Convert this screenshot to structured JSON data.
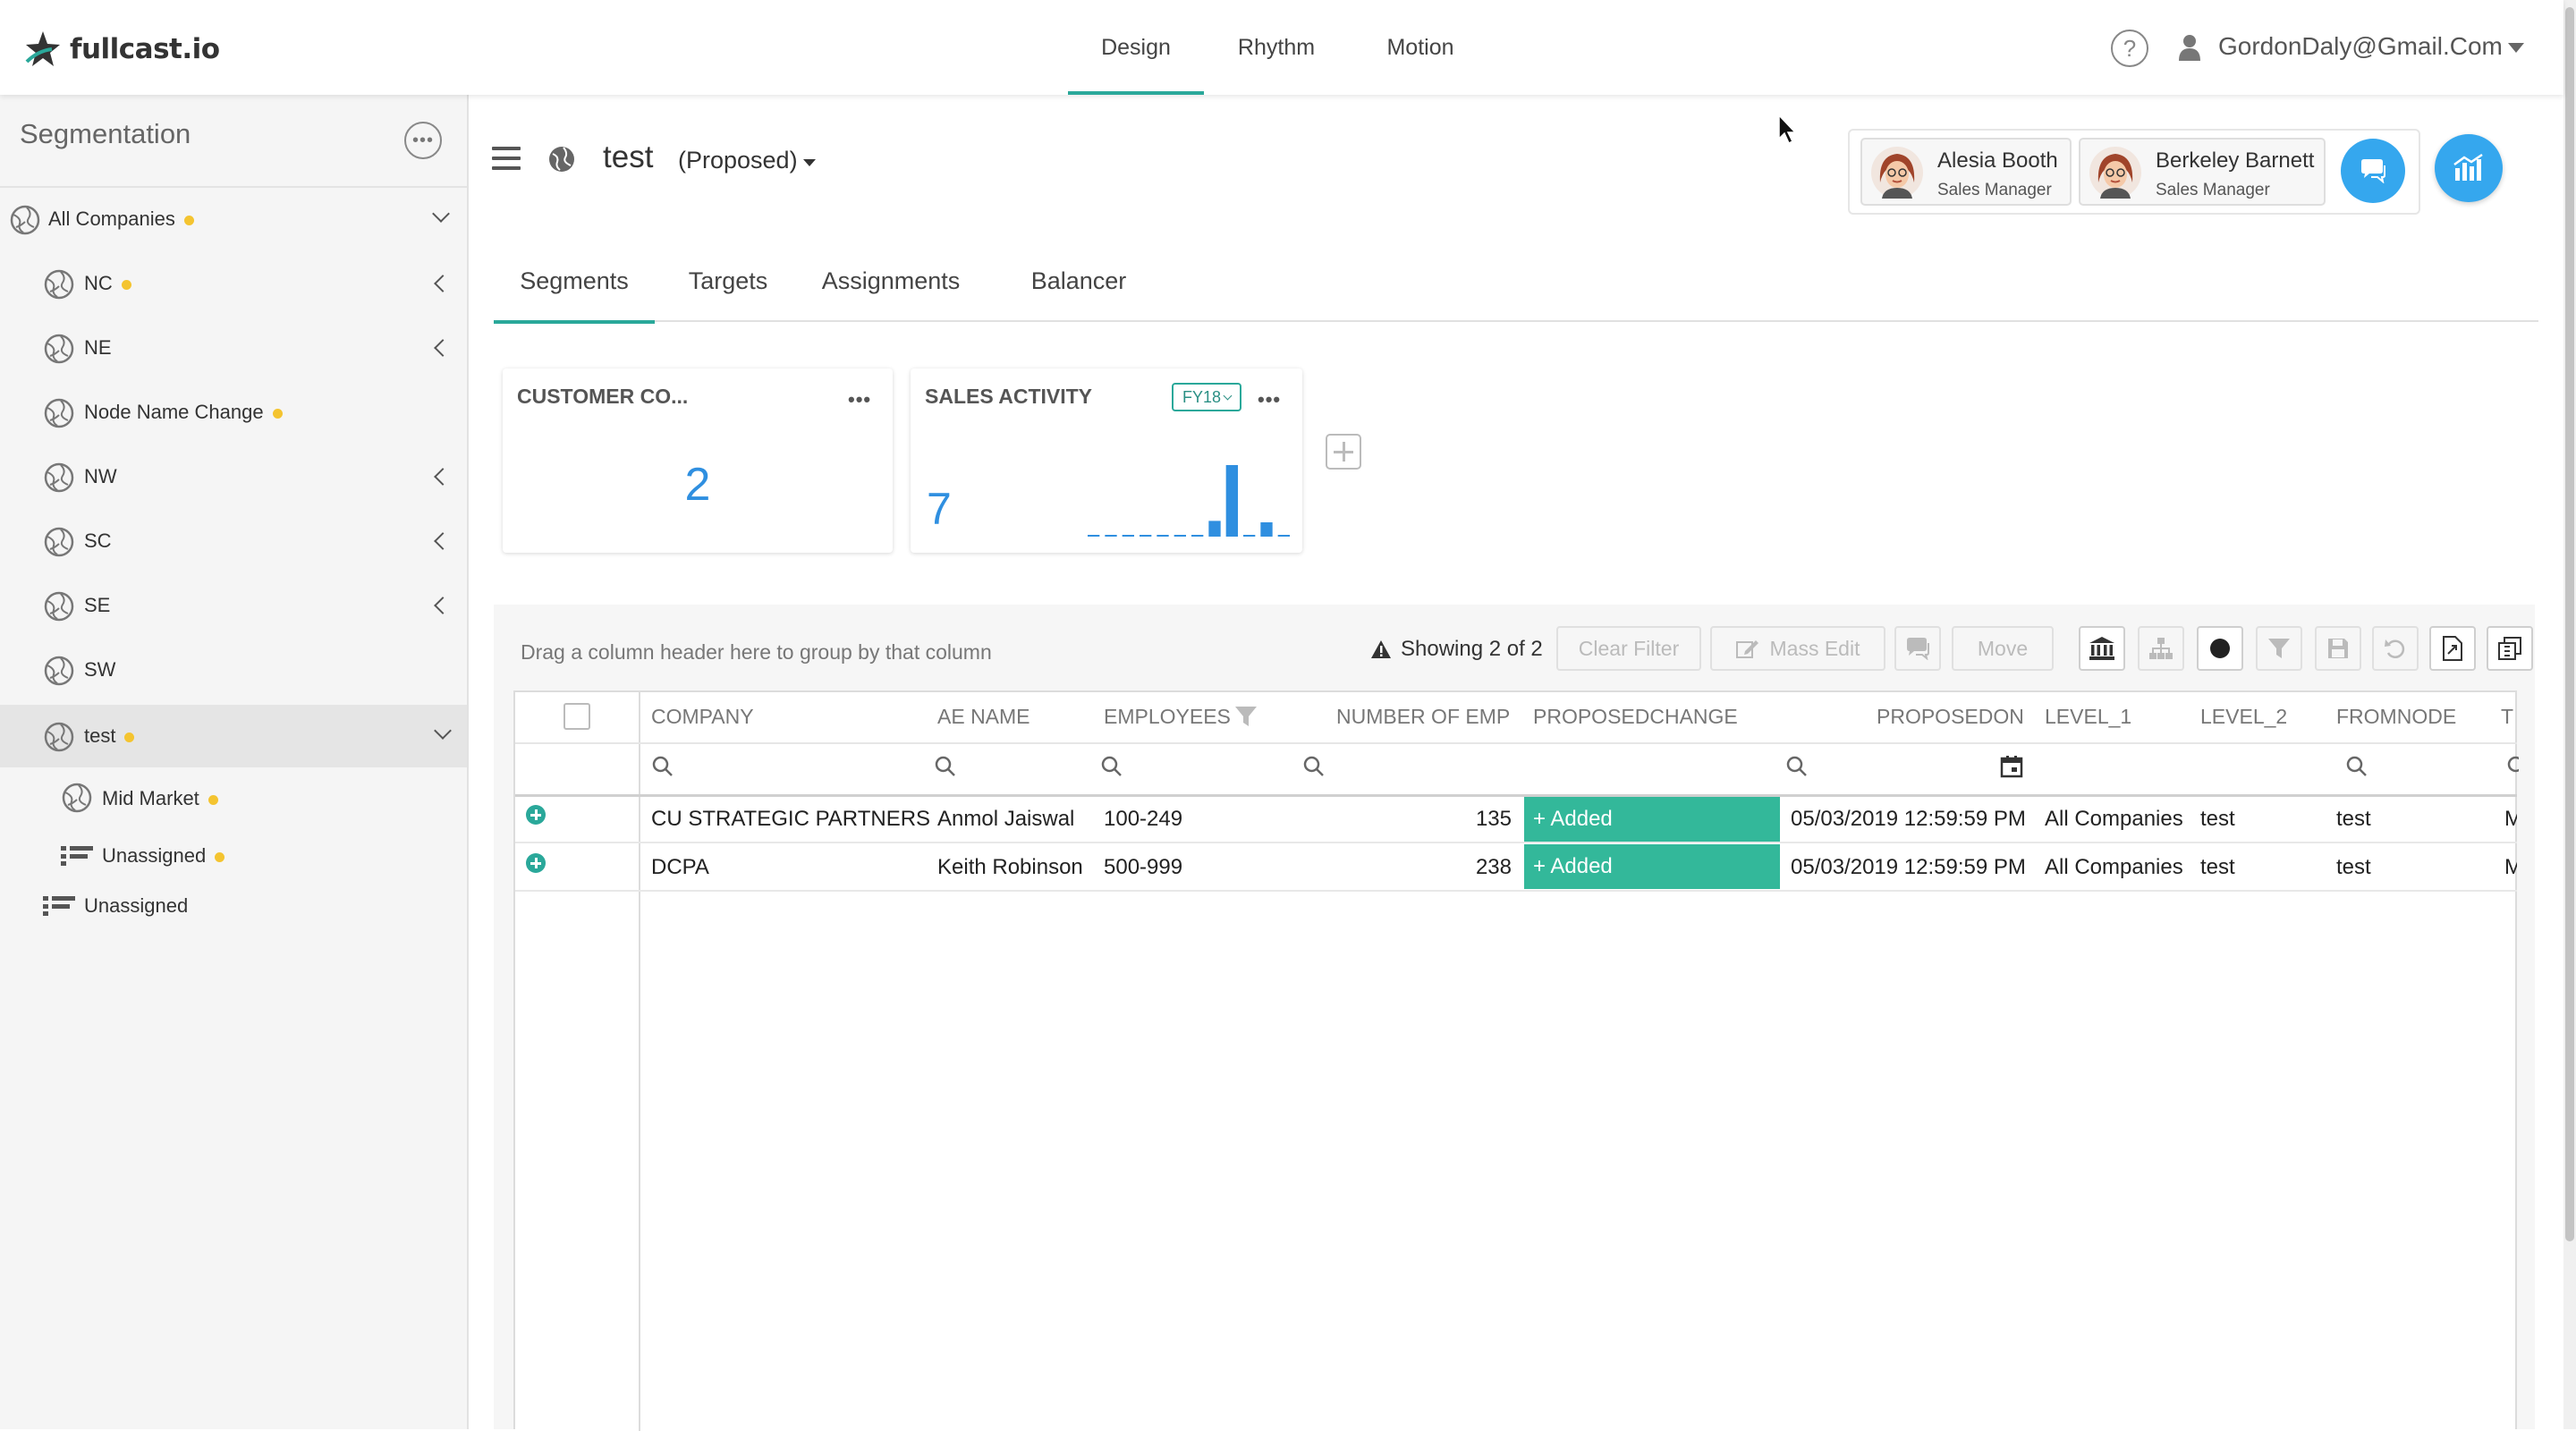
{
  "app": {
    "logo_text": "fullcast.io"
  },
  "topnav": {
    "tabs": [
      {
        "label": "Design",
        "active": true
      },
      {
        "label": "Rhythm",
        "active": false
      },
      {
        "label": "Motion",
        "active": false
      }
    ],
    "help_label": "?",
    "user_email": "GordonDaly@Gmail.Com"
  },
  "sidebar": {
    "title": "Segmentation",
    "more_label": "•••",
    "items": [
      {
        "label": "All Companies",
        "dot": true,
        "chevron": "down"
      },
      {
        "label": "NC",
        "dot": true,
        "chevron": "left"
      },
      {
        "label": "NE",
        "dot": false,
        "chevron": "left"
      },
      {
        "label": "Node Name Change",
        "dot": true,
        "chevron": ""
      },
      {
        "label": "NW",
        "dot": false,
        "chevron": "left"
      },
      {
        "label": "SC",
        "dot": false,
        "chevron": "left"
      },
      {
        "label": "SE",
        "dot": false,
        "chevron": "left"
      },
      {
        "label": "SW",
        "dot": false,
        "chevron": ""
      },
      {
        "label": "test",
        "dot": true,
        "chevron": "down",
        "selected": true
      },
      {
        "label": "Mid Market",
        "dot": true,
        "chevron": ""
      },
      {
        "label": "Unassigned",
        "dot": true,
        "chevron": ""
      },
      {
        "label": "Unassigned",
        "dot": false,
        "chevron": ""
      }
    ]
  },
  "header": {
    "title": "test",
    "status": "(Proposed)",
    "people": [
      {
        "name": "Alesia Booth",
        "role": "Sales Manager"
      },
      {
        "name": "Berkeley Barnett",
        "role": "Sales Manager"
      }
    ]
  },
  "subtabs": [
    {
      "label": "Segments",
      "active": true
    },
    {
      "label": "Targets",
      "active": false
    },
    {
      "label": "Assignments",
      "active": false
    },
    {
      "label": "Balancer",
      "active": false
    }
  ],
  "widgets": {
    "customer": {
      "title": "CUSTOMER CO...",
      "value": "2",
      "more": "•••"
    },
    "sales": {
      "title": "SALES ACTIVITY",
      "value": "7",
      "fy": "FY18",
      "more": "•••",
      "spark": [
        0,
        0,
        0,
        0,
        0,
        0,
        0,
        0.22,
        1.0,
        0,
        0.2,
        0
      ]
    }
  },
  "grid": {
    "group_hint": "Drag a column header here to group by that column",
    "showing": "Showing 2 of 2",
    "toolbar": {
      "clear_filter": "Clear Filter",
      "mass_edit": "Mass Edit",
      "move": "Move"
    },
    "columns": [
      "COMPANY",
      "AE NAME",
      "EMPLOYEES",
      "NUMBER OF EMP",
      "PROPOSEDCHANGE",
      "PROPOSEDON",
      "LEVEL_1",
      "LEVEL_2",
      "FROMNODE",
      "T"
    ],
    "rows": [
      {
        "company": "CU STRATEGIC PARTNERS",
        "ae_name": "Anmol Jaiswal",
        "employees": "100-249",
        "number_of_emp": "135",
        "proposed_change": "+ Added",
        "proposed_on": "05/03/2019 12:59:59 PM",
        "level_1": "All Companies",
        "level_2": "test",
        "from_node": "test",
        "t": "M"
      },
      {
        "company": "DCPA",
        "ae_name": "Keith Robinson",
        "employees": "500-999",
        "number_of_emp": "238",
        "proposed_change": "+ Added",
        "proposed_on": "05/03/2019 12:59:59 PM",
        "level_1": "All Companies",
        "level_2": "test",
        "from_node": "test",
        "t": "M"
      }
    ]
  },
  "colors": {
    "accent": "#2aa89a",
    "blue": "#35a7ee",
    "added": "#33b89a",
    "dot": "#f4c430"
  }
}
